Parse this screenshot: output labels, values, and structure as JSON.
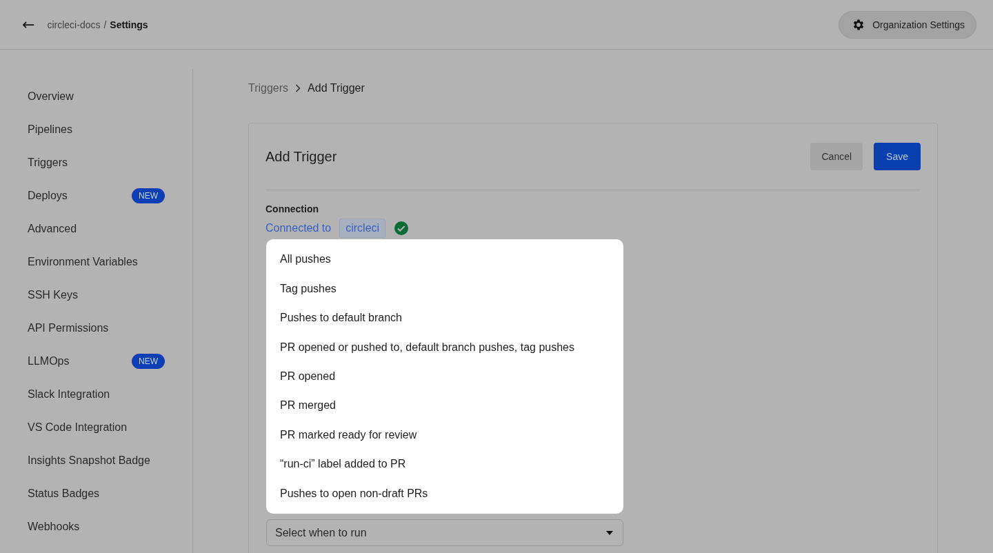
{
  "header": {
    "back": "←",
    "breadcrumb": {
      "org": "circleci-docs",
      "separator": "/",
      "page": "Settings"
    },
    "org_settings_button": "Organization Settings"
  },
  "sidebar": {
    "items": [
      {
        "label": "Overview"
      },
      {
        "label": "Pipelines"
      },
      {
        "label": "Triggers"
      },
      {
        "label": "Deploys",
        "badge": "NEW"
      },
      {
        "label": "Advanced"
      },
      {
        "label": "Environment Variables"
      },
      {
        "label": "SSH Keys"
      },
      {
        "label": "API Permissions"
      },
      {
        "label": "LLMOps",
        "badge": "NEW"
      },
      {
        "label": "Slack Integration"
      },
      {
        "label": "VS Code Integration"
      },
      {
        "label": "Insights Snapshot Badge"
      },
      {
        "label": "Status Badges"
      },
      {
        "label": "Webhooks"
      }
    ]
  },
  "breadcrumb": {
    "parent": "Triggers",
    "current": "Add Trigger"
  },
  "card": {
    "title": "Add Trigger",
    "buttons": [
      {
        "label": "Cancel",
        "kind": "secondary"
      },
      {
        "label": "Save",
        "kind": "primary"
      }
    ],
    "connection": {
      "label": "Connection",
      "link": "Connected to",
      "chip": "circleci"
    },
    "select": {
      "placeholder": "Select when to run"
    }
  },
  "dropdown": {
    "options": [
      "All pushes",
      "Tag pushes",
      "Pushes to default branch",
      "PR opened or pushed to, default branch pushes, tag pushes",
      "PR opened",
      "PR merged",
      "PR marked ready for review",
      "“run-ci” label added to PR",
      "Pushes to open non-draft PRs"
    ]
  }
}
